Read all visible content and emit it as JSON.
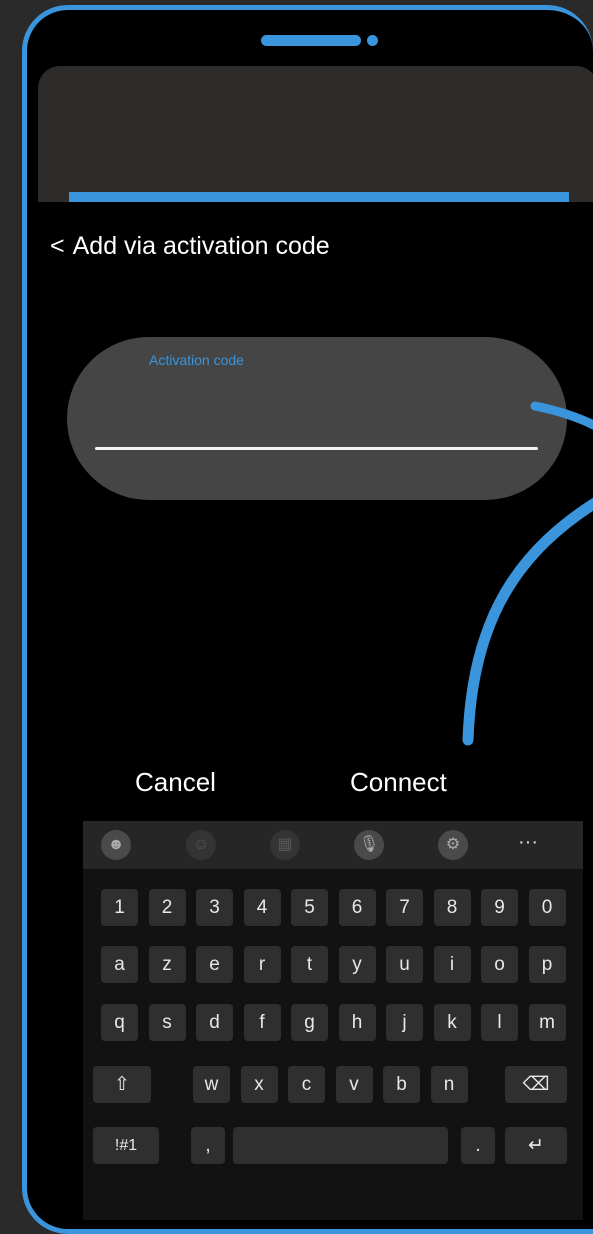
{
  "screen": {
    "back_chevron": "<",
    "title": "Add via activation code"
  },
  "form": {
    "field_label": "Activation code",
    "field_value": "",
    "field_placeholder": ""
  },
  "actions": {
    "cancel_label": "Cancel",
    "connect_label": "Connect"
  },
  "colors": {
    "accent": "#3a95dc",
    "background": "#000000",
    "frame_outer": "#2a2a2a",
    "field_background": "#454545"
  },
  "keyboard": {
    "toolbar_icons": [
      "emoji-icon",
      "sticker-icon",
      "gif-icon",
      "microphone-icon",
      "settings-icon",
      "more-icon"
    ],
    "toolbar_symbols": [
      "☻",
      "☺",
      "▦",
      "🎙",
      "⚙",
      "···"
    ],
    "row_numbers": [
      "1",
      "2",
      "3",
      "4",
      "5",
      "6",
      "7",
      "8",
      "9",
      "0"
    ],
    "row_1": [
      "a",
      "z",
      "e",
      "r",
      "t",
      "y",
      "u",
      "i",
      "o",
      "p"
    ],
    "row_2": [
      "q",
      "s",
      "d",
      "f",
      "g",
      "h",
      "j",
      "k",
      "l",
      "m"
    ],
    "row_3": [
      "w",
      "x",
      "c",
      "v",
      "b",
      "n"
    ],
    "shift_symbol": "⇧",
    "backspace_symbol": "⌫",
    "symbols_label": "!#1",
    "comma": ",",
    "period": ".",
    "enter_symbol": "↵"
  }
}
